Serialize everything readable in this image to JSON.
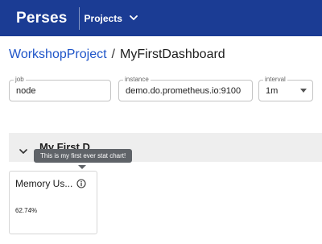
{
  "header": {
    "brand": "Perses",
    "projects_label": "Projects"
  },
  "breadcrumb": {
    "project": "WorkshopProject",
    "separator": "/",
    "dashboard": "MyFirstDashboard"
  },
  "variables": {
    "job": {
      "label": "job",
      "value": "node"
    },
    "instance": {
      "label": "instance",
      "value": "demo.do.prometheus.io:9100"
    },
    "interval": {
      "label": "interval",
      "value": "1m"
    }
  },
  "section": {
    "title": "My First D"
  },
  "tooltip": {
    "text": "This is my first ever stat chart!"
  },
  "panel": {
    "title": "Memory Us...",
    "value": "62.74%"
  },
  "colors": {
    "topbar": "#1b3c94",
    "link": "#1e54c8",
    "section_bg": "#eeeeee",
    "tooltip_bg": "#5f6368"
  },
  "icons": {
    "projects_dropdown": "chevron-down-icon",
    "section_toggle": "chevron-down-icon",
    "panel_info": "info-icon"
  }
}
